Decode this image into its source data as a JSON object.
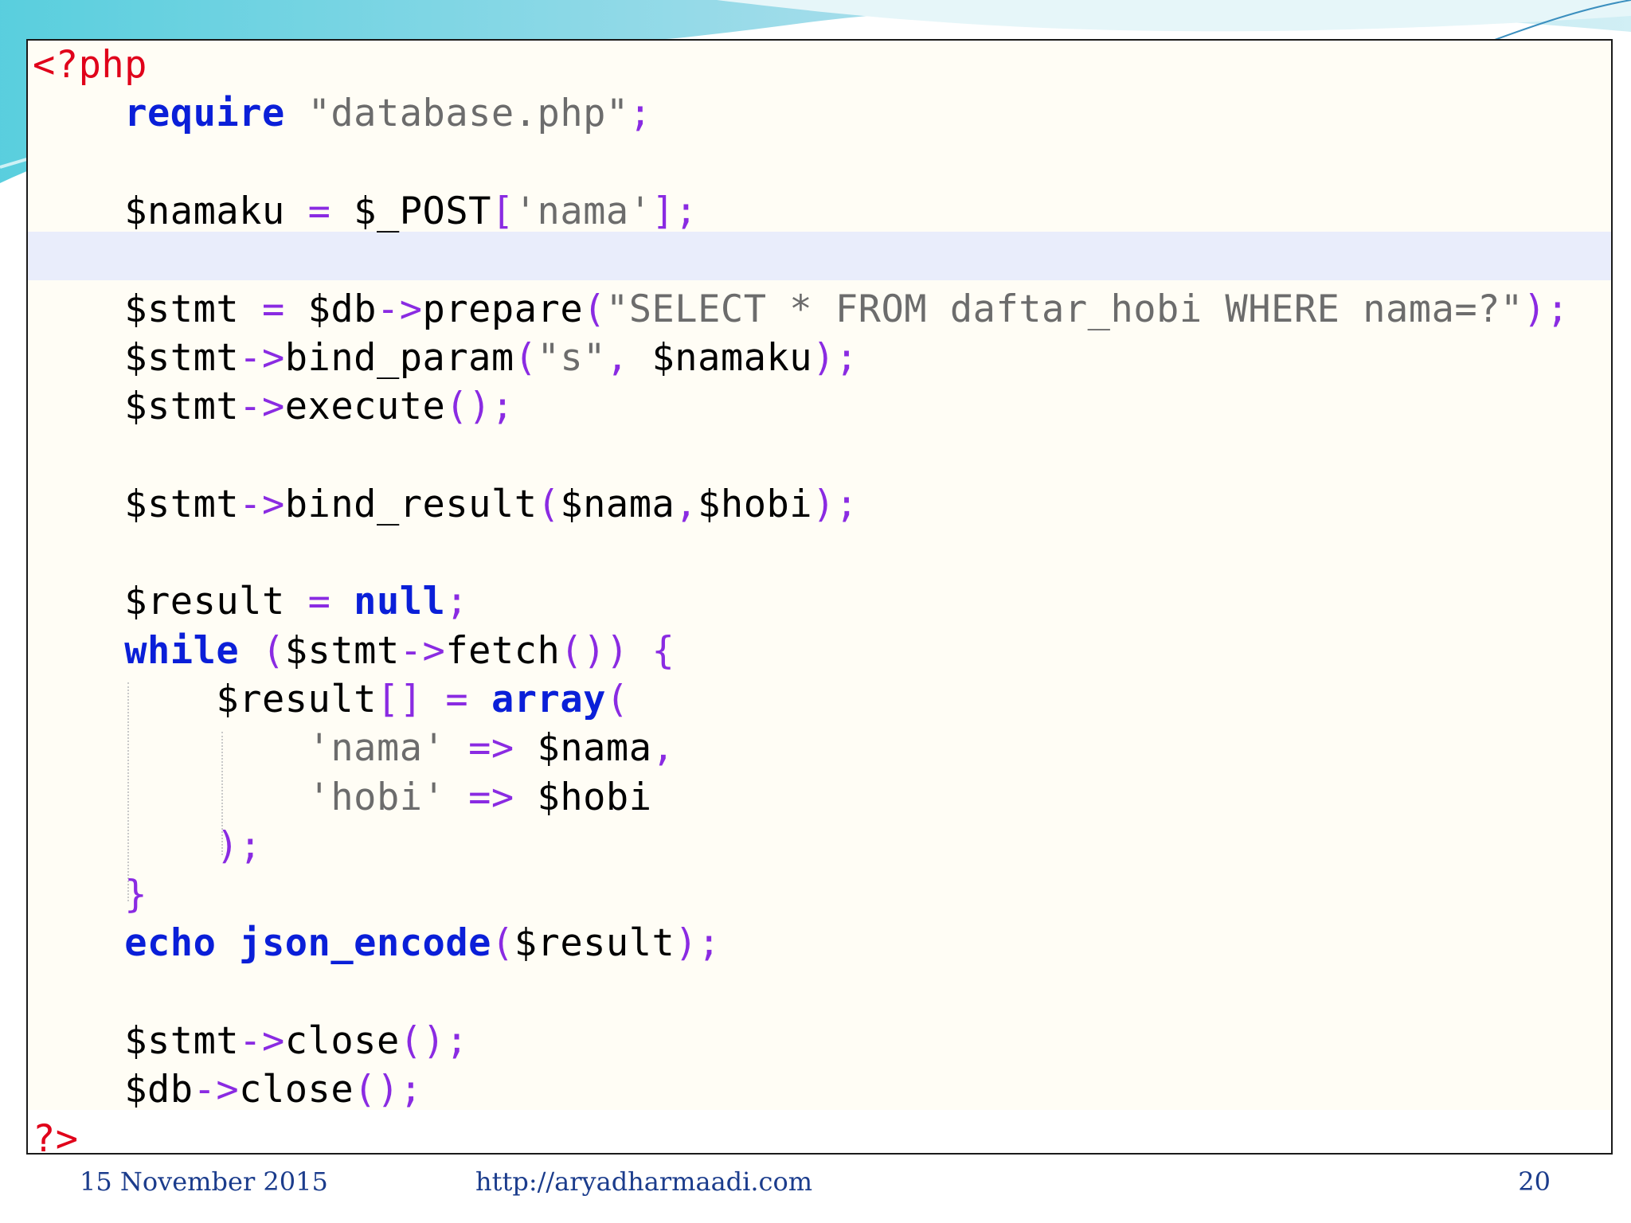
{
  "colors": {
    "php_delimiter": "#e0001a",
    "keyword": "#0a1fd8",
    "string": "#6c6c6c",
    "operator": "#8a2be2",
    "variable": "#000000",
    "footer_text": "#1b3c8c",
    "highlight_line": "#e9edfb",
    "panel_bg": "#fffdf5"
  },
  "code_lines": [
    [
      {
        "c": "delim",
        "t": "<?php"
      }
    ],
    [
      {
        "c": "plain",
        "t": "    "
      },
      {
        "c": "kw",
        "t": "require"
      },
      {
        "c": "plain",
        "t": " "
      },
      {
        "c": "str",
        "t": "\"database.php\""
      },
      {
        "c": "op",
        "t": ";"
      }
    ],
    [],
    [
      {
        "c": "plain",
        "t": "    "
      },
      {
        "c": "var",
        "t": "$namaku"
      },
      {
        "c": "plain",
        "t": " "
      },
      {
        "c": "op",
        "t": "="
      },
      {
        "c": "plain",
        "t": " "
      },
      {
        "c": "var",
        "t": "$_POST"
      },
      {
        "c": "op",
        "t": "["
      },
      {
        "c": "str",
        "t": "'nama'"
      },
      {
        "c": "op",
        "t": "];"
      }
    ],
    [],
    [
      {
        "c": "plain",
        "t": "    "
      },
      {
        "c": "var",
        "t": "$stmt"
      },
      {
        "c": "plain",
        "t": " "
      },
      {
        "c": "op",
        "t": "="
      },
      {
        "c": "plain",
        "t": " "
      },
      {
        "c": "var",
        "t": "$db"
      },
      {
        "c": "op",
        "t": "->"
      },
      {
        "c": "fn",
        "t": "prepare"
      },
      {
        "c": "op",
        "t": "("
      },
      {
        "c": "str",
        "t": "\"SELECT * FROM daftar_hobi WHERE nama=?\""
      },
      {
        "c": "op",
        "t": ");"
      }
    ],
    [
      {
        "c": "plain",
        "t": "    "
      },
      {
        "c": "var",
        "t": "$stmt"
      },
      {
        "c": "op",
        "t": "->"
      },
      {
        "c": "fn",
        "t": "bind_param"
      },
      {
        "c": "op",
        "t": "("
      },
      {
        "c": "str",
        "t": "\"s\""
      },
      {
        "c": "op",
        "t": ","
      },
      {
        "c": "plain",
        "t": " "
      },
      {
        "c": "var",
        "t": "$namaku"
      },
      {
        "c": "op",
        "t": ");"
      }
    ],
    [
      {
        "c": "plain",
        "t": "    "
      },
      {
        "c": "var",
        "t": "$stmt"
      },
      {
        "c": "op",
        "t": "->"
      },
      {
        "c": "fn",
        "t": "execute"
      },
      {
        "c": "op",
        "t": "();"
      }
    ],
    [],
    [
      {
        "c": "plain",
        "t": "    "
      },
      {
        "c": "var",
        "t": "$stmt"
      },
      {
        "c": "op",
        "t": "->"
      },
      {
        "c": "fn",
        "t": "bind_result"
      },
      {
        "c": "op",
        "t": "("
      },
      {
        "c": "var",
        "t": "$nama"
      },
      {
        "c": "op",
        "t": ","
      },
      {
        "c": "var",
        "t": "$hobi"
      },
      {
        "c": "op",
        "t": ");"
      }
    ],
    [],
    [
      {
        "c": "plain",
        "t": "    "
      },
      {
        "c": "var",
        "t": "$result"
      },
      {
        "c": "plain",
        "t": " "
      },
      {
        "c": "op",
        "t": "="
      },
      {
        "c": "plain",
        "t": " "
      },
      {
        "c": "kw",
        "t": "null"
      },
      {
        "c": "op",
        "t": ";"
      }
    ],
    [
      {
        "c": "plain",
        "t": "    "
      },
      {
        "c": "kw",
        "t": "while"
      },
      {
        "c": "plain",
        "t": " "
      },
      {
        "c": "op",
        "t": "("
      },
      {
        "c": "var",
        "t": "$stmt"
      },
      {
        "c": "op",
        "t": "->"
      },
      {
        "c": "fn",
        "t": "fetch"
      },
      {
        "c": "op",
        "t": "())"
      },
      {
        "c": "plain",
        "t": " "
      },
      {
        "c": "op",
        "t": "{"
      }
    ],
    [
      {
        "c": "plain",
        "t": "        "
      },
      {
        "c": "var",
        "t": "$result"
      },
      {
        "c": "op",
        "t": "[]"
      },
      {
        "c": "plain",
        "t": " "
      },
      {
        "c": "op",
        "t": "="
      },
      {
        "c": "plain",
        "t": " "
      },
      {
        "c": "kw",
        "t": "array"
      },
      {
        "c": "op",
        "t": "("
      }
    ],
    [
      {
        "c": "plain",
        "t": "            "
      },
      {
        "c": "str",
        "t": "'nama'"
      },
      {
        "c": "plain",
        "t": " "
      },
      {
        "c": "op",
        "t": "=>"
      },
      {
        "c": "plain",
        "t": " "
      },
      {
        "c": "var",
        "t": "$nama"
      },
      {
        "c": "op",
        "t": ","
      }
    ],
    [
      {
        "c": "plain",
        "t": "            "
      },
      {
        "c": "str",
        "t": "'hobi'"
      },
      {
        "c": "plain",
        "t": " "
      },
      {
        "c": "op",
        "t": "=>"
      },
      {
        "c": "plain",
        "t": " "
      },
      {
        "c": "var",
        "t": "$hobi"
      }
    ],
    [
      {
        "c": "plain",
        "t": "        "
      },
      {
        "c": "op",
        "t": ");"
      }
    ],
    [
      {
        "c": "plain",
        "t": "    "
      },
      {
        "c": "op",
        "t": "}"
      }
    ],
    [
      {
        "c": "plain",
        "t": "    "
      },
      {
        "c": "kw",
        "t": "echo"
      },
      {
        "c": "plain",
        "t": " "
      },
      {
        "c": "kw",
        "t": "json_encode"
      },
      {
        "c": "op",
        "t": "("
      },
      {
        "c": "var",
        "t": "$result"
      },
      {
        "c": "op",
        "t": ");"
      }
    ],
    [],
    [
      {
        "c": "plain",
        "t": "    "
      },
      {
        "c": "var",
        "t": "$stmt"
      },
      {
        "c": "op",
        "t": "->"
      },
      {
        "c": "fn",
        "t": "close"
      },
      {
        "c": "op",
        "t": "();"
      }
    ],
    [
      {
        "c": "plain",
        "t": "    "
      },
      {
        "c": "var",
        "t": "$db"
      },
      {
        "c": "op",
        "t": "->"
      },
      {
        "c": "fn",
        "t": "close"
      },
      {
        "c": "op",
        "t": "();"
      }
    ],
    [
      {
        "c": "delim",
        "t": "?>"
      }
    ]
  ],
  "footer": {
    "date": "15 November 2015",
    "url": "http://aryadharmaadi.com",
    "page_number": "20"
  }
}
